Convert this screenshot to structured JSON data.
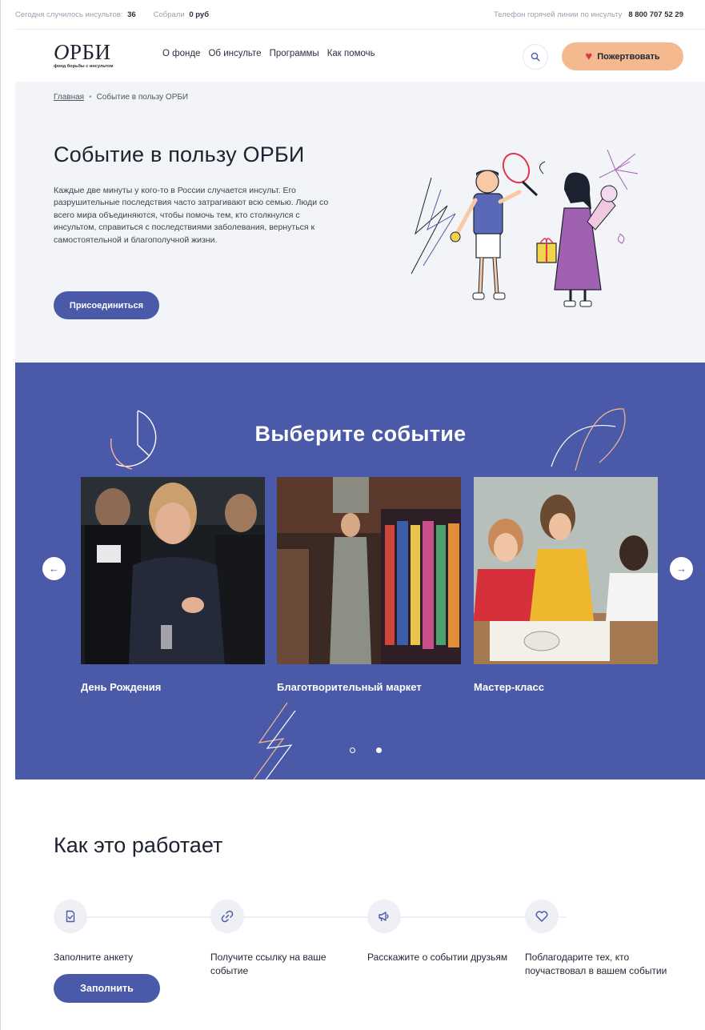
{
  "topbar": {
    "strokes_label": "Сегодня случилось инсультов:",
    "strokes_value": "36",
    "collected_label": "Собрали",
    "collected_value": "0 руб",
    "hotline_label": "Телефон горячей линии по инсульту",
    "hotline_phone": "8 800 707 52 29"
  },
  "header": {
    "logo_word": "ОРБИ",
    "logo_first": "О",
    "logo_rest": "РБИ",
    "logo_sub": "фонд борьбы с инсультом",
    "nav": [
      "О фонде",
      "Об инсульте",
      "Программы",
      "Как помочь"
    ],
    "donate_label": "Пожертвовать"
  },
  "breadcrumb": {
    "home": "Главная",
    "separator": "•",
    "current": "Событие в пользу ОРБИ"
  },
  "hero": {
    "title": "Событие в пользу ОРБИ",
    "description": "Каждые две минуты у кого-то в России случается инсульт. Его разрушительные последствия часто затрагивают всю семью. Люди со всего мира объединяются, чтобы помочь тем, кто столкнулся с инсультом, справиться с последствиями заболевания, вернуться к самостоятельной и благополучной жизни.",
    "join_label": "Присоединиться"
  },
  "events": {
    "title": "Выберите событие",
    "cards": [
      {
        "title": "День Рождения"
      },
      {
        "title": "Благотворительный маркет"
      },
      {
        "title": "Мастер-класс"
      }
    ],
    "prev_icon": "←",
    "next_icon": "→",
    "pages": 2,
    "active_page": 2
  },
  "how": {
    "title": "Как это работает",
    "steps": [
      {
        "icon": "form-icon",
        "text": "Заполните анкету"
      },
      {
        "icon": "link-icon",
        "text": "Получите ссылку на ваше событие"
      },
      {
        "icon": "megaphone-icon",
        "text": "Расскажите о событии друзьям"
      },
      {
        "icon": "heart-icon",
        "text": "Поблагодарите тех, кто поучаствовал в вашем событии"
      }
    ],
    "fill_label": "Заполнить"
  },
  "colors": {
    "primary": "#4b5aa8",
    "donate": "#f5b98f",
    "hero_bg": "#f2f4f8",
    "heart": "#e2354a"
  }
}
